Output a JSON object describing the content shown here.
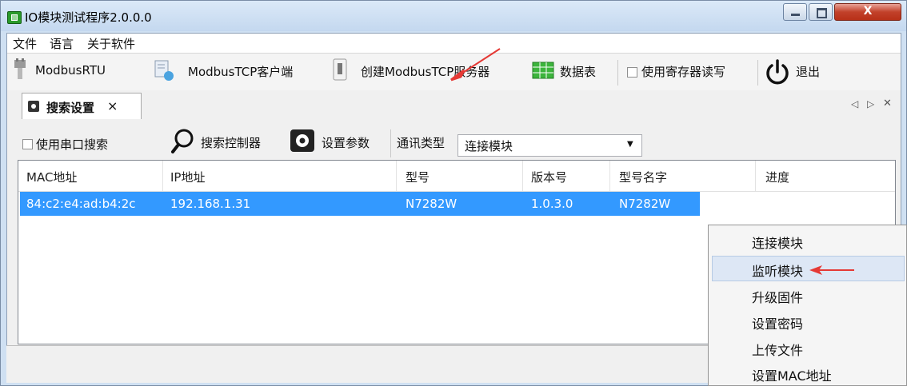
{
  "window": {
    "title": "IO模块测试程序2.0.0.0",
    "close_label": "X"
  },
  "menu": {
    "items": [
      "文件",
      "语言",
      "关于软件"
    ]
  },
  "toolbar": {
    "modbus_rtu": "ModbusRTU",
    "modbus_tcp_client": "ModbusTCP客户端",
    "create_tcp_server": "创建ModbusTCP服务器",
    "data_table": "数据表",
    "use_register_rw": "使用寄存器读写",
    "exit": "退出"
  },
  "tabs": {
    "active": "搜索设置",
    "close_glyph": "×",
    "nav": [
      "◁",
      "▷",
      "✕"
    ]
  },
  "search": {
    "use_serial_search": "使用串口搜索",
    "search_controller": "搜索控制器",
    "set_params": "设置参数",
    "comm_type_label": "通讯类型",
    "comm_type_value": "连接模块",
    "dropdown_arrow": "▼"
  },
  "table": {
    "headers": [
      "MAC地址",
      "IP地址",
      "型号",
      "版本号",
      "型号名字",
      "进度"
    ],
    "rows": [
      [
        "84:c2:e4:ad:b4:2c",
        "192.168.1.31",
        "N7282W",
        "1.0.3.0",
        "N7282W",
        ""
      ]
    ]
  },
  "context_menu": {
    "items": [
      "连接模块",
      "监听模块",
      "升级固件",
      "设置密码",
      "上传文件",
      "设置MAC地址"
    ],
    "highlighted_index": 1
  },
  "colors": {
    "selection": "#3399ff",
    "arrow": "#e53935",
    "close_button": "#c2412a"
  }
}
